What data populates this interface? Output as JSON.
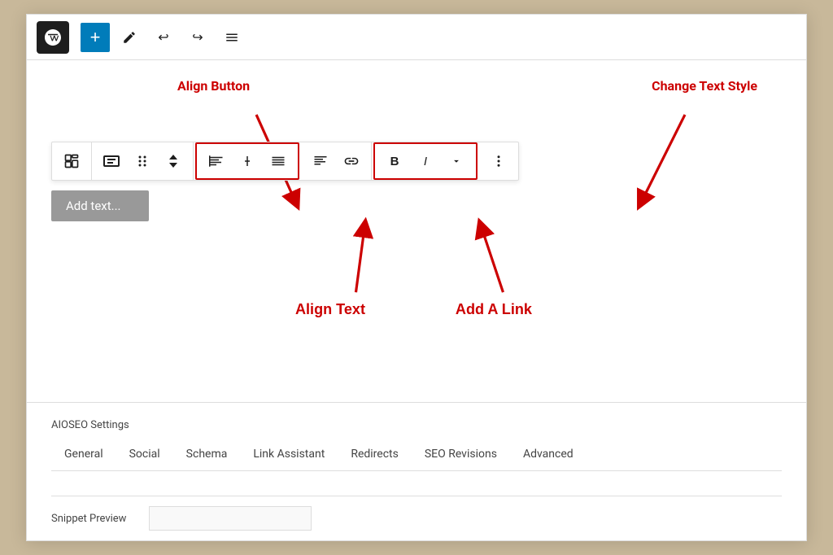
{
  "toolbar": {
    "add_btn_label": "+",
    "undo_icon": "↩",
    "redo_icon": "↪",
    "menu_icon": "≡"
  },
  "annotations": {
    "align_button": "Align Button",
    "change_text_style": "Change Text Style",
    "align_text": "Align Text",
    "add_a_link": "Add A Link"
  },
  "block_toolbar": {
    "group1": [
      "⊞",
      "⊟",
      "⋮⋮",
      "⌃"
    ],
    "align_group": [
      "⊢",
      "+",
      "≡"
    ],
    "mid_group": [
      "≡",
      "↺"
    ],
    "style_group": [
      "B",
      "I",
      "∨"
    ],
    "more_btn": "⋮"
  },
  "add_text_placeholder": "Add text...",
  "aioseo": {
    "section_title": "AIOSEO Settings",
    "tabs": [
      {
        "label": "General"
      },
      {
        "label": "Social"
      },
      {
        "label": "Schema"
      },
      {
        "label": "Link Assistant"
      },
      {
        "label": "Redirects"
      },
      {
        "label": "SEO Revisions"
      },
      {
        "label": "Advanced"
      }
    ]
  },
  "snippet_preview": {
    "label": "Snippet Preview"
  }
}
